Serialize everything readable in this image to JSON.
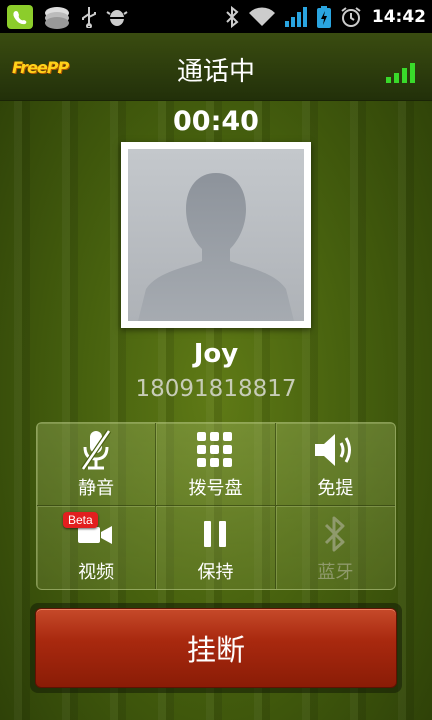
{
  "status_bar": {
    "time": "14:42",
    "icons": [
      "freepp-notification-icon",
      "cloud-icon",
      "usb-icon",
      "android-debug-icon",
      "bluetooth-icon",
      "wifi-icon",
      "cell-signal-icon",
      "battery-charging-icon",
      "alarm-icon"
    ]
  },
  "header": {
    "logo_text": "FreePP",
    "title": "通话中",
    "signal_icon": "signal-strength-icon"
  },
  "call": {
    "duration": "00:40",
    "contact_name": "Joy",
    "contact_number": "18091818817"
  },
  "controls": [
    {
      "label": "静音",
      "icon": "mute-mic-icon",
      "enabled": true
    },
    {
      "label": "拨号盘",
      "icon": "dialpad-icon",
      "enabled": true
    },
    {
      "label": "免提",
      "icon": "speaker-icon",
      "enabled": true
    },
    {
      "label": "视频",
      "icon": "video-camera-icon",
      "enabled": true,
      "badge": "Beta"
    },
    {
      "label": "保持",
      "icon": "pause-icon",
      "enabled": true
    },
    {
      "label": "蓝牙",
      "icon": "bluetooth-icon",
      "enabled": false
    }
  ],
  "hangup_label": "挂断",
  "colors": {
    "accent_green": "#39d92a",
    "hangup_red": "#a9290f",
    "beta_badge": "#e21f1f"
  }
}
